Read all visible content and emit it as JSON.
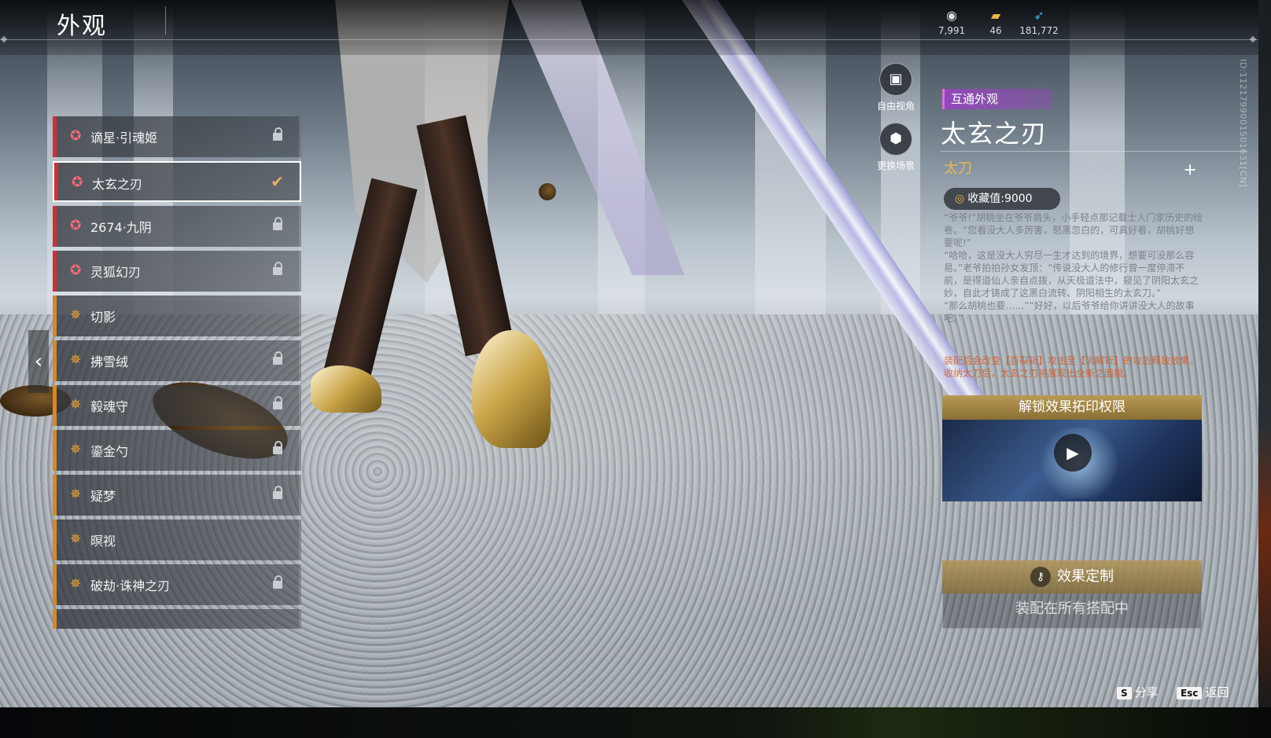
{
  "header": {
    "title": "外观",
    "currencies": [
      {
        "icon": "coin-icon",
        "value": "7,991"
      },
      {
        "icon": "ticket-icon",
        "value": "46"
      },
      {
        "icon": "feather-icon",
        "value": "181,772"
      }
    ],
    "id_text": "ID:1121799001501631[CN]"
  },
  "list": {
    "items": [
      {
        "label": "谪星·引魂姬",
        "rarity": "red",
        "state": "locked"
      },
      {
        "label": "太玄之刃",
        "rarity": "red",
        "state": "selected"
      },
      {
        "label": "2674·九阴",
        "rarity": "red",
        "state": "locked"
      },
      {
        "label": "灵狐幻刃",
        "rarity": "red",
        "state": "locked"
      },
      {
        "label": "切影",
        "rarity": "gold",
        "state": "unlocked"
      },
      {
        "label": "拂雪绒",
        "rarity": "gold",
        "state": "locked"
      },
      {
        "label": "毅魂守",
        "rarity": "gold",
        "state": "locked"
      },
      {
        "label": "鎏金勺",
        "rarity": "gold",
        "state": "locked"
      },
      {
        "label": "疑梦",
        "rarity": "gold",
        "state": "locked"
      },
      {
        "label": "暝视",
        "rarity": "gold",
        "state": "unlocked"
      },
      {
        "label": "破劫·诛神之刃",
        "rarity": "gold",
        "state": "locked"
      }
    ]
  },
  "view_buttons": {
    "free_view": "自由视角",
    "change_scene": "更换场景"
  },
  "detail": {
    "tag": "互通外观",
    "name": "太玄之刃",
    "type": "太刀",
    "collection_label": "收藏值:",
    "collection_value": "9000",
    "description": "“爷爷!”胡桃坐在爷爷肩头，小手轻点那记载士人门家历史的绘卷。“您看没大人多厉害，怒黑忽白的，可真好看，胡桃好想要呢!”\n“哈哈，这是没大人穷尽一生才达到的境界，想要可没那么容易。”老爷拍拍孙女发顶：“传说没大人的修行曾一度停滞不前，是得道仙人亲自点拨，从天极道法中，窥见了阴阳太玄之妙，自此才铸成了这黑白流转、阴阳相生的太玄刀。”\n“那么胡桃也要……”“好好，以后爷爷给你讲讲没大人的故事吧。”",
    "effect_text": "装配后会改变【百裂斩】攻击至【消解斩】的攻击释放效果。\n收纳太刀后，太玄之刃将展现出全新之面貌。",
    "unlock_header": "解锁效果拓印权限",
    "custom_button": "效果定制",
    "equip_status": "装配在所有搭配中"
  },
  "footer": {
    "share_key": "S",
    "share_label": "分享",
    "back_key": "Esc",
    "back_label": "返回"
  }
}
